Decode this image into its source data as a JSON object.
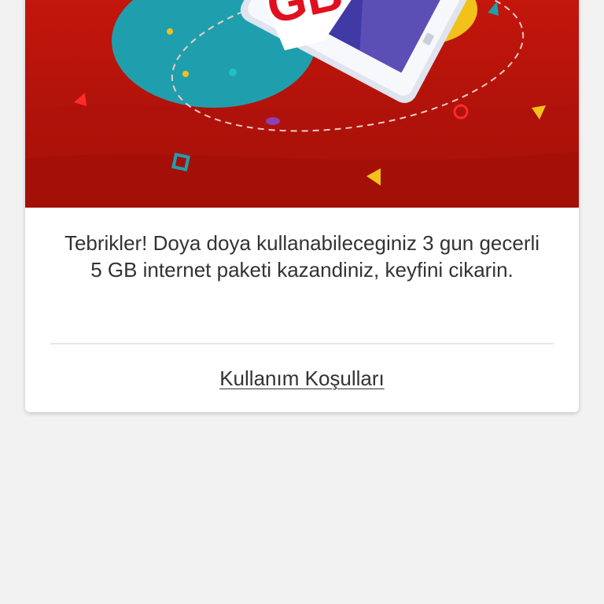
{
  "promo": {
    "banner": {
      "graphic": "phone-with-gb-illustration",
      "badge_text": "GB",
      "colors": {
        "background": "#b51409",
        "accent_teal": "#1f9fae",
        "accent_yellow": "#f2c21b",
        "accent_purple": "#5b4fb5",
        "badge_red": "#e0101f"
      }
    },
    "message": "Tebrikler! Doya doya kullanabileceginiz 3 gun gecerli 5 GB internet paketi kazandiniz, keyfini cikarin.",
    "terms_link": "Kullanım Koşulları"
  },
  "page": {
    "background": "#f2f2f2"
  }
}
